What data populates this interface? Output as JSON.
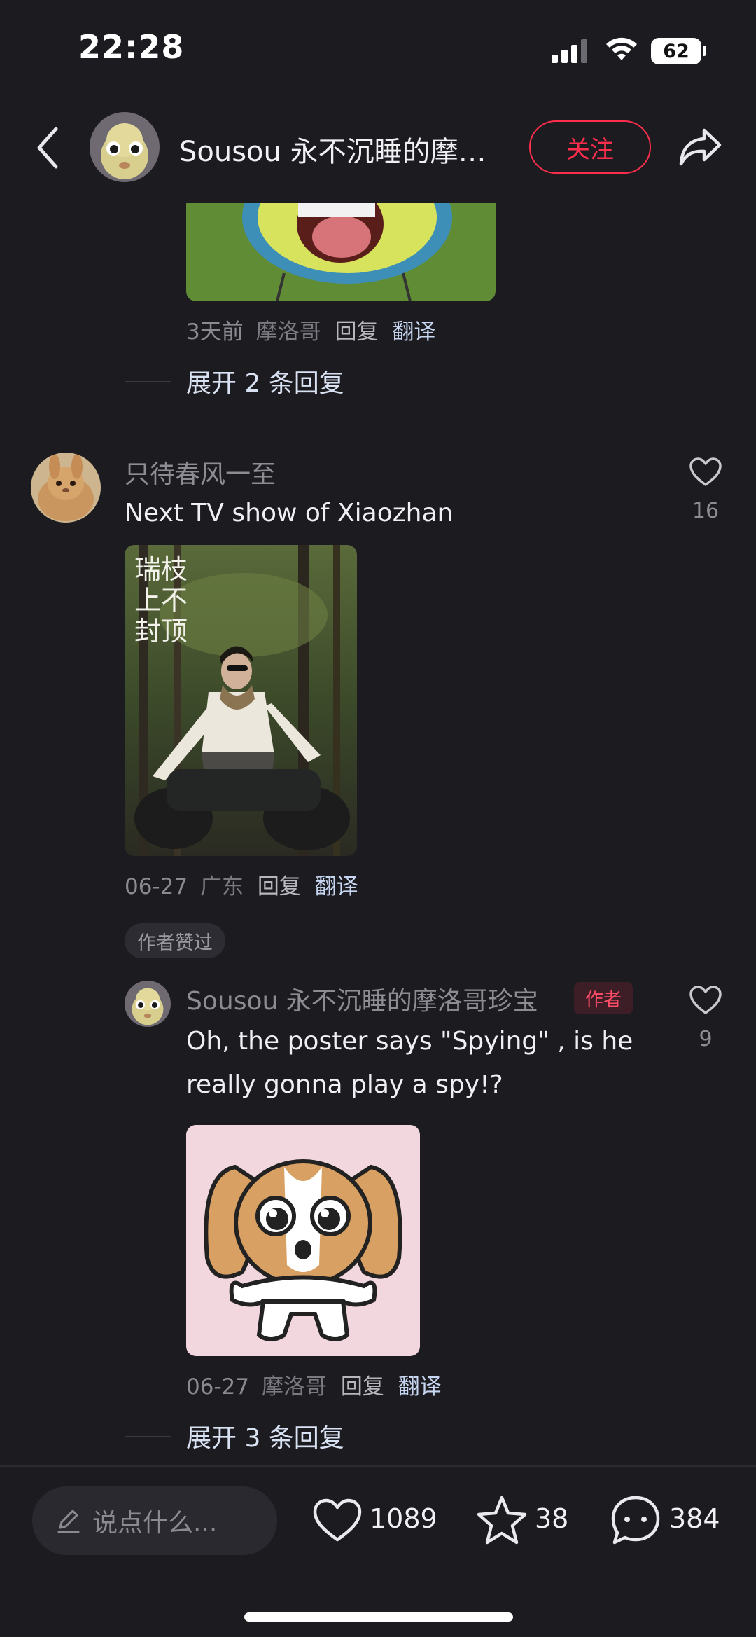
{
  "status_bar": {
    "time": "22:28",
    "battery": "62"
  },
  "header": {
    "author_name": "Sousou 永不沉睡的摩洛哥珍宝",
    "follow_label": "关注"
  },
  "top_reply": {
    "meta_time": "3天前",
    "meta_location": "摩洛哥",
    "reply_label": "回复",
    "translate_label": "翻译",
    "expand_label": "展开 2 条回复"
  },
  "comment": {
    "nickname": "只待春风一至",
    "text": "Next TV show of Xiaozhan",
    "likes": "16",
    "poster_text": "瑞枝上不封顶",
    "meta_time": "06-27",
    "meta_location": "广东",
    "reply_label": "回复",
    "translate_label": "翻译",
    "author_liked_badge": "作者赞过"
  },
  "author_reply": {
    "nickname": "Sousou 永不沉睡的摩洛哥珍宝",
    "author_tag": "作者",
    "text": "Oh, the poster says \"Spying\" , is he really gonna play a spy!?",
    "likes": "9",
    "meta_time": "06-27",
    "meta_location": "摩洛哥",
    "reply_label": "回复",
    "translate_label": "翻译",
    "expand_label": "展开 3 条回复"
  },
  "bottom_bar": {
    "input_placeholder": "说点什么...",
    "likes": "1089",
    "stars": "38",
    "comments": "384"
  },
  "colors": {
    "background": "#1c1b20",
    "accent_red": "#ff2e4d",
    "translate_blue": "#c7d7f2"
  }
}
